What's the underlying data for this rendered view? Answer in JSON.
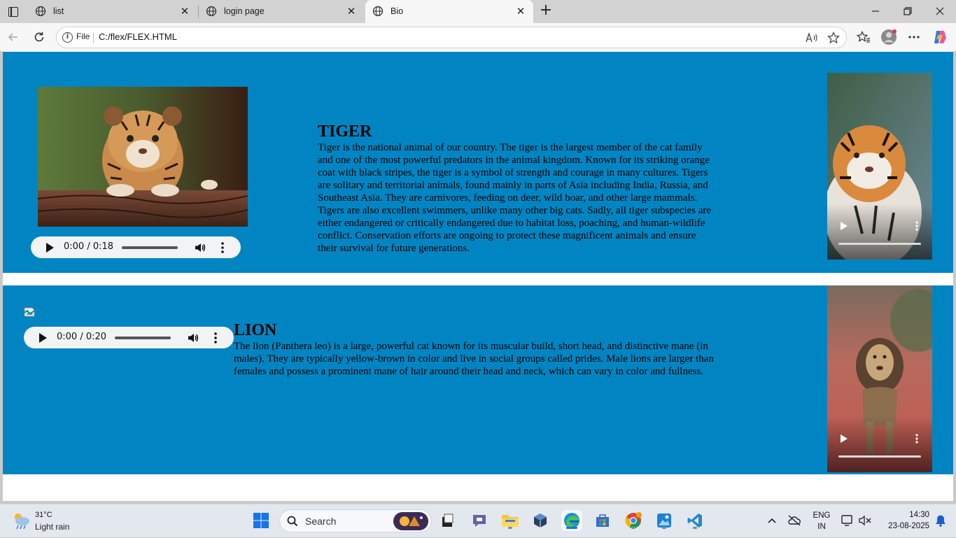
{
  "browser": {
    "tabs": [
      {
        "label": "list",
        "active": false
      },
      {
        "label": "login page",
        "active": false
      },
      {
        "label": "Bio",
        "active": true
      }
    ],
    "address": {
      "scheme_label": "File",
      "url": "C:/flex/FLEX.HTML"
    }
  },
  "page": {
    "background": "#0085c2",
    "tiger": {
      "title": "TIGER",
      "body": "Tiger is the national animal of our country. The tiger is the largest member of the cat family and one of the most powerful predators in the animal kingdom. Known for its striking orange coat with black stripes, the tiger is a symbol of strength and courage in many cultures. Tigers are solitary and territorial animals, found mainly in parts of Asia including India, Russia, and Southeast Asia. They are carnivores, feeding on deer, wild boar, and other large mammals. Tigers are also excellent swimmers, unlike many other big cats. Sadly, all tiger subspecies are either endangered or critically endangered due to habitat loss, poaching, and human-wildlife conflict. Conservation efforts are ongoing to protect these magnificent animals and ensure their survival for future generations.",
      "audio_time": "0:00 / 0:18"
    },
    "lion": {
      "title": "LION",
      "body": "The lion (Panthera leo) is a large, powerful cat known for its muscular build, short head, and distinctive mane (in males). They are typically yellow-brown in color and live in social groups called prides. Male lions are larger than females and possess a prominent mane of hair around their head and neck, which can vary in color and fullness.",
      "audio_time": "0:00 / 0:20"
    }
  },
  "taskbar": {
    "weather": {
      "temp": "31°C",
      "desc": "Light rain"
    },
    "search_label": "Search",
    "lang": {
      "line1": "ENG",
      "line2": "IN"
    },
    "clock": {
      "time": "14:30",
      "date": "23-08-2025"
    }
  }
}
